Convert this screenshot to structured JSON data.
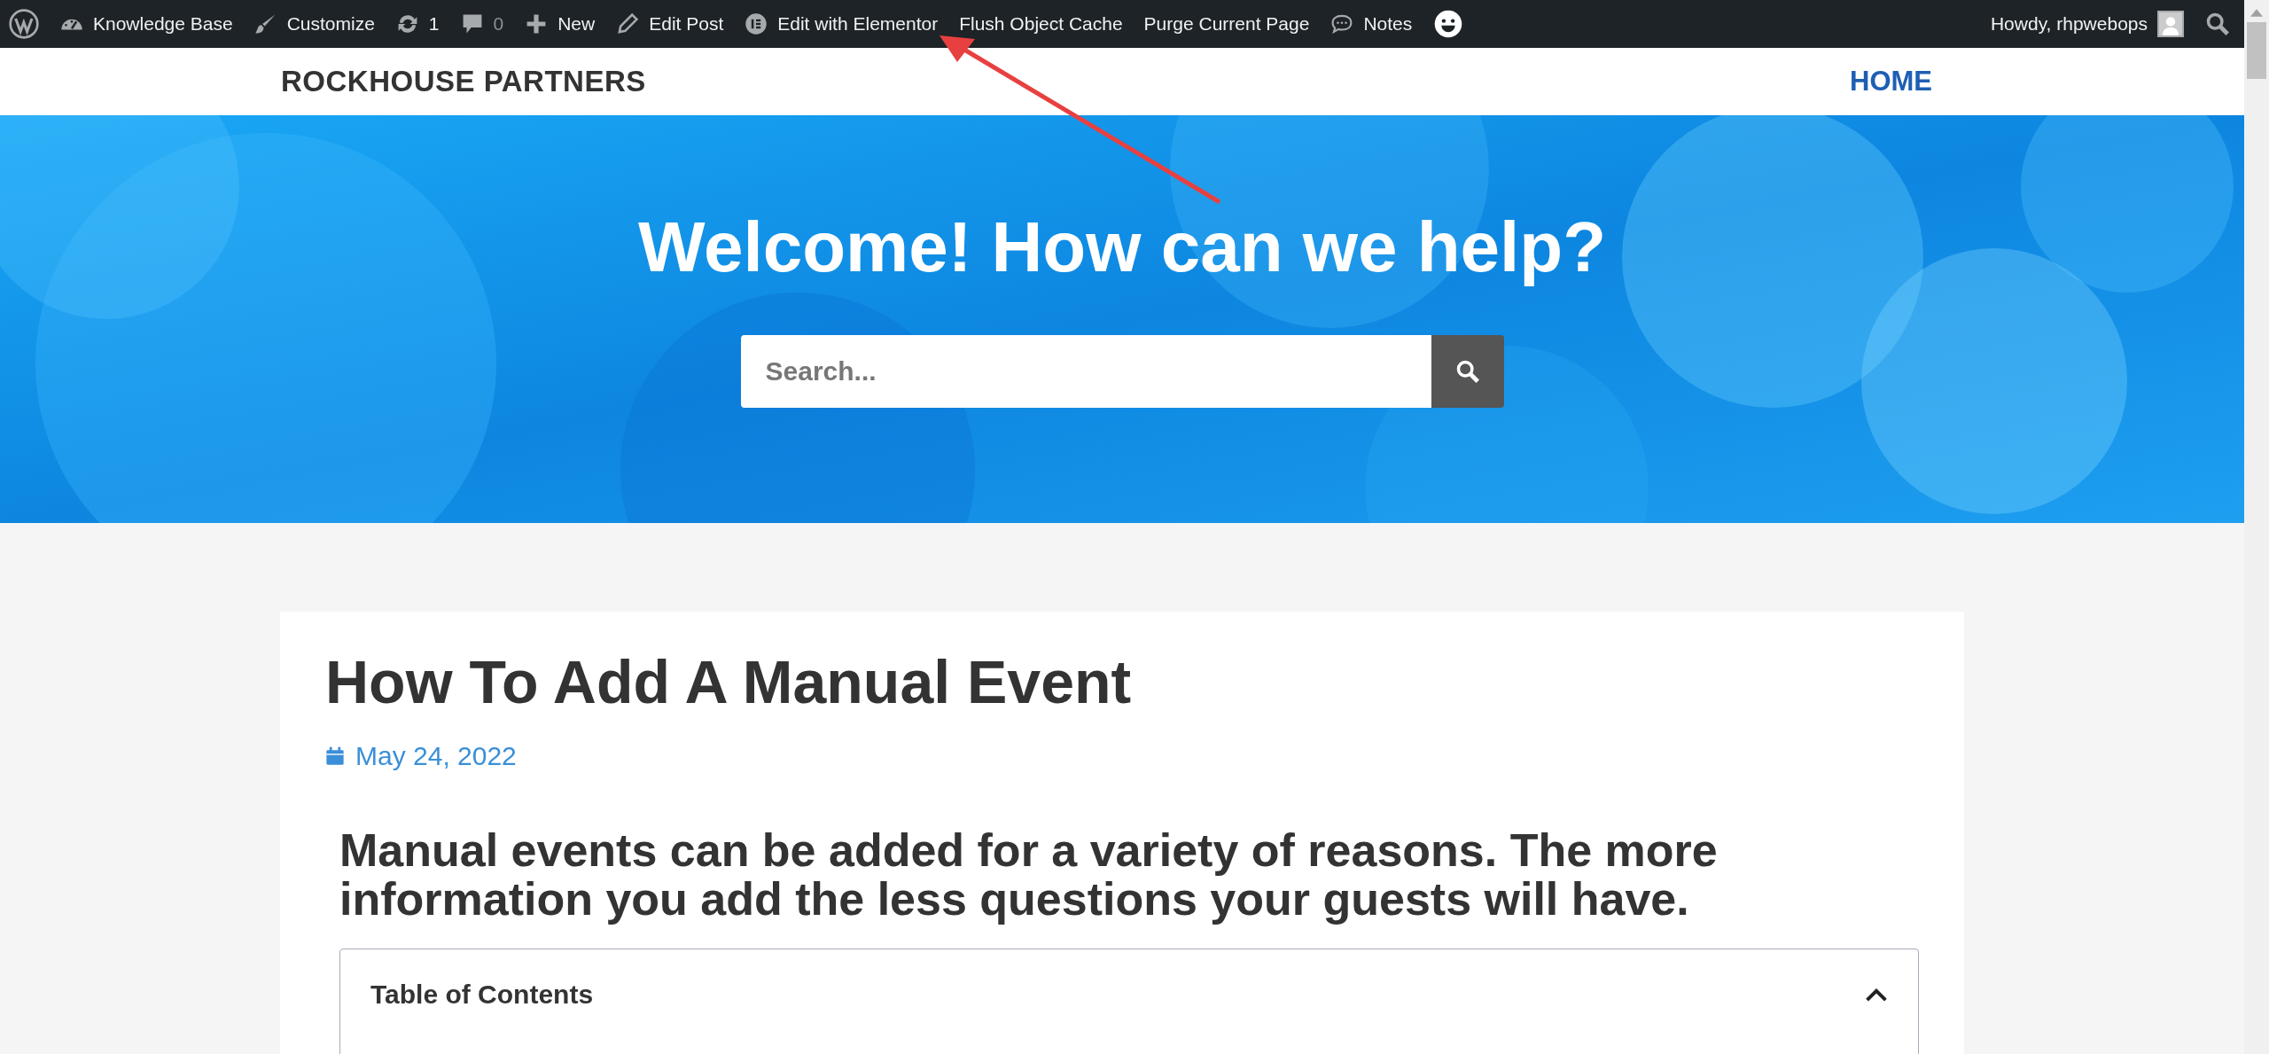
{
  "admin_bar": {
    "items": [
      {
        "kind": "wp"
      },
      {
        "kind": "dashboard",
        "label": "Knowledge Base"
      },
      {
        "kind": "brush",
        "label": "Customize"
      },
      {
        "kind": "updates",
        "label": "1"
      },
      {
        "kind": "comments",
        "label": "0"
      },
      {
        "kind": "plus",
        "label": "New"
      },
      {
        "kind": "pencil",
        "label": "Edit Post"
      },
      {
        "kind": "elementor",
        "label": "Edit with Elementor"
      },
      {
        "kind": "text",
        "label": "Flush Object Cache"
      },
      {
        "kind": "text",
        "label": "Purge Current Page"
      },
      {
        "kind": "notes",
        "label": "Notes"
      },
      {
        "kind": "face"
      }
    ],
    "account": {
      "greeting": "Howdy, rhpwebops"
    }
  },
  "header": {
    "site_title": "ROCKHOUSE PARTNERS",
    "nav": [
      {
        "label": "HOME",
        "selected": true
      }
    ]
  },
  "hero": {
    "heading": "Welcome! How can we help?",
    "search": {
      "placeholder": "Search..."
    }
  },
  "article": {
    "title": "How To Add A Manual Event",
    "date": "May 24, 2022",
    "lead": "Manual events can be added for a variety of reasons. The more information you add the less questions your guests will have.",
    "toc": {
      "title": "Table of Contents",
      "expanded": true
    }
  }
}
